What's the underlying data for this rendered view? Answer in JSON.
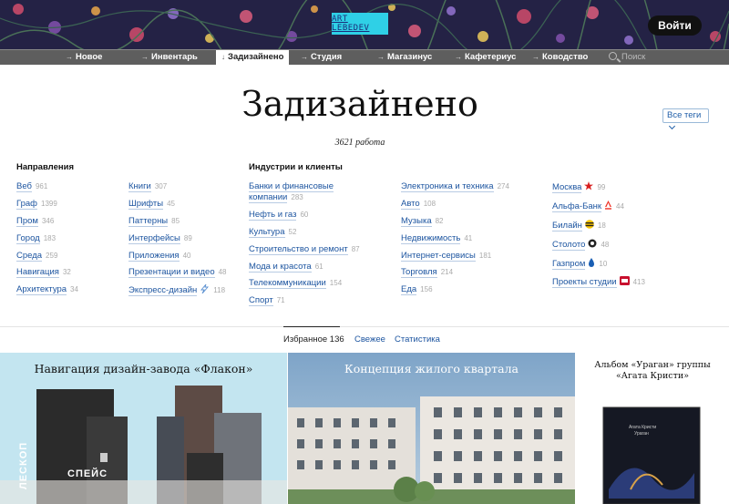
{
  "header": {
    "logo_text": "ART LEBEDEV",
    "login_label": "Войти"
  },
  "nav": {
    "items": [
      {
        "label": "Новое"
      },
      {
        "label": "Инвентарь"
      },
      {
        "label": "Задизайнено",
        "active": true
      },
      {
        "label": "Студия"
      },
      {
        "label": "Магазинус"
      },
      {
        "label": "Кафетериус"
      },
      {
        "label": "Ководство"
      }
    ],
    "search_placeholder": "Поиск"
  },
  "page": {
    "title": "Задизайнено",
    "works_count": "3621 работа",
    "tags_button": "Все теги"
  },
  "directions": {
    "heading": "Направления",
    "col1": [
      {
        "label": "Веб",
        "count": "961"
      },
      {
        "label": "Граф",
        "count": "1399"
      },
      {
        "label": "Пром",
        "count": "346"
      },
      {
        "label": "Город",
        "count": "183"
      },
      {
        "label": "Среда",
        "count": "259"
      },
      {
        "label": "Навигация",
        "count": "32"
      },
      {
        "label": "Архитектура",
        "count": "34"
      }
    ],
    "col2": [
      {
        "label": "Книги",
        "count": "307"
      },
      {
        "label": "Шрифты",
        "count": "45"
      },
      {
        "label": "Паттерны",
        "count": "85"
      },
      {
        "label": "Интерфейсы",
        "count": "89"
      },
      {
        "label": "Приложения",
        "count": "40"
      },
      {
        "label": "Презентации и видео",
        "count": "48"
      },
      {
        "label": "Экспресс-дизайн",
        "count": "118",
        "icon": "lightning-icon"
      }
    ]
  },
  "industries": {
    "heading": "Индустрии и клиенты",
    "col1": [
      {
        "label": "Банки и финансовые компании",
        "count": "283"
      },
      {
        "label": "Нефть и газ",
        "count": "60"
      },
      {
        "label": "Культура",
        "count": "52"
      },
      {
        "label": "Строительство и ремонт",
        "count": "87"
      },
      {
        "label": "Мода и красота",
        "count": "61"
      },
      {
        "label": "Телекоммуникации",
        "count": "154"
      },
      {
        "label": "Спорт",
        "count": "71"
      }
    ],
    "col2": [
      {
        "label": "Электроника и техника",
        "count": "274"
      },
      {
        "label": "Авто",
        "count": "108"
      },
      {
        "label": "Музыка",
        "count": "82"
      },
      {
        "label": "Недвижимость",
        "count": "41"
      },
      {
        "label": "Интернет-сервисы",
        "count": "181"
      },
      {
        "label": "Торговля",
        "count": "214"
      },
      {
        "label": "Еда",
        "count": "156"
      }
    ],
    "col3": [
      {
        "label": "Москва",
        "count": "99",
        "icon": "moscow-star-icon"
      },
      {
        "label": "Альфа-Банк",
        "count": "44",
        "icon": "alfa-bank-icon"
      },
      {
        "label": "Билайн",
        "count": "18",
        "icon": "beeline-icon"
      },
      {
        "label": "Столото",
        "count": "48",
        "icon": "stoloto-icon"
      },
      {
        "label": "Газпром",
        "count": "10",
        "icon": "gazprom-icon"
      },
      {
        "label": "Проекты студии",
        "count": "413",
        "icon": "studio-icon"
      }
    ]
  },
  "tabs": {
    "favorites": "Избранное 136",
    "fresh": "Свежее",
    "stats": "Статистика"
  },
  "cards": [
    {
      "title": "Навигация дизайн-завода «Флакон»",
      "sign_text": "СПЕЙС",
      "vertical_text": "ЛЕСКОП"
    },
    {
      "title": "Концепция жилого квартала"
    },
    {
      "title": "Альбом «Ураган» группы «Агата Кристи»",
      "album_artist": "Агата Кристи",
      "album_name": "Ураган"
    }
  ],
  "colors": {
    "link": "#1d55a0",
    "nav_bg": "#5e5e5e",
    "banner_bg": "#242245",
    "logo_bg": "#2fd0e6"
  }
}
